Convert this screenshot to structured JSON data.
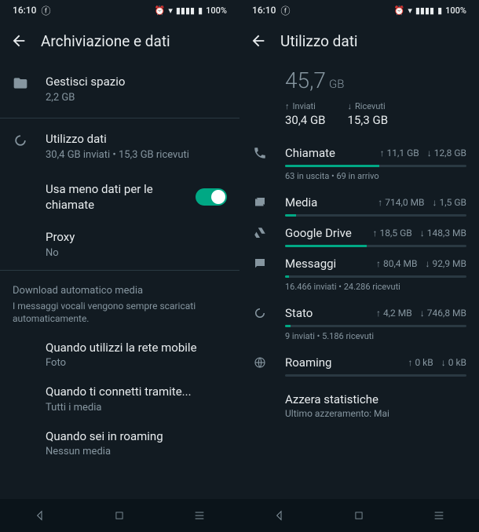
{
  "status": {
    "time": "16:10",
    "battery": "100%"
  },
  "left": {
    "title": "Archiviazione e dati",
    "storage": {
      "label": "Gestisci spazio",
      "value": "2,2 GB"
    },
    "usage": {
      "label": "Utilizzo dati",
      "summary": "30,4 GB inviati • 15,3 GB ricevuti"
    },
    "lessData": {
      "label": "Usa meno dati per le chiamate"
    },
    "proxy": {
      "label": "Proxy",
      "value": "No"
    },
    "autoHeader": "Download automatico media",
    "autoCaption": "I messaggi vocali vengono sempre scaricati automaticamente.",
    "mobile": {
      "label": "Quando utilizzi la rete mobile",
      "value": "Foto"
    },
    "wifi": {
      "label": "Quando ti connetti tramite...",
      "value": "Tutti i media"
    },
    "roaming": {
      "label": "Quando sei in roaming",
      "value": "Nessun media"
    }
  },
  "right": {
    "title": "Utilizzo dati",
    "total": {
      "value": "45,7",
      "unit": "GB"
    },
    "sent": {
      "label": "Inviati",
      "value": "30,4 GB"
    },
    "recv": {
      "label": "Ricevuti",
      "value": "15,3 GB"
    },
    "cats": {
      "calls": {
        "label": "Chiamate",
        "up": "11,1 GB",
        "down": "12,8 GB",
        "caption": "63 in uscita • 69 in arrivo",
        "pct": 52
      },
      "media": {
        "label": "Media",
        "up": "714,0 MB",
        "down": "1,5 GB",
        "caption": "",
        "pct": 6
      },
      "drive": {
        "label": "Google Drive",
        "up": "18,5 GB",
        "down": "148,3 MB",
        "caption": "",
        "pct": 45
      },
      "msgs": {
        "label": "Messaggi",
        "up": "80,4 MB",
        "down": "92,9 MB",
        "caption": "16.466 inviati • 24.286 ricevuti",
        "pct": 2
      },
      "status": {
        "label": "Stato",
        "up": "4,2 MB",
        "down": "746,8 MB",
        "caption": "9 inviati • 5.186 ricevuti",
        "pct": 3
      },
      "roaming": {
        "label": "Roaming",
        "up": "0 kB",
        "down": "0 kB",
        "caption": "",
        "pct": 0
      }
    },
    "reset": {
      "label": "Azzera statistiche",
      "value": "Ultimo azzeramento: Mai"
    }
  }
}
